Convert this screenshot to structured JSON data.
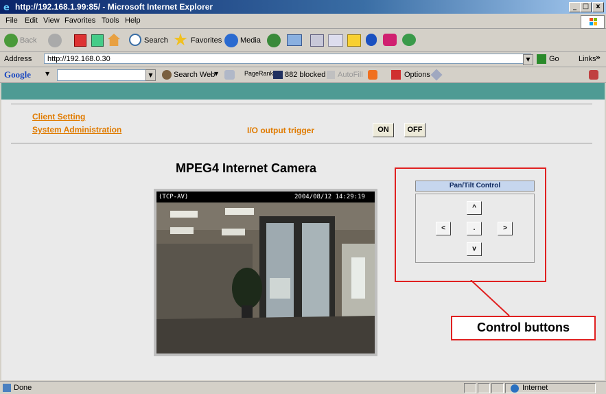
{
  "window": {
    "title": "http://192.168.1.99:85/ - Microsoft Internet Explorer",
    "controls": {
      "minimize": "_",
      "maximize": "□",
      "close": "x"
    }
  },
  "menu": [
    "File",
    "Edit",
    "View",
    "Favorites",
    "Tools",
    "Help"
  ],
  "toolbar": {
    "back": "Back",
    "search": "Search",
    "favorites": "Favorites",
    "media": "Media"
  },
  "address": {
    "label": "Address",
    "url": "http://192.168.0.30",
    "go": "Go",
    "links": "Links"
  },
  "googlebar": {
    "brand": "Google",
    "search_web": "Search Web",
    "pagerank": "PageRank",
    "blocked": "882 blocked",
    "autofill": "AutoFill",
    "options": "Options"
  },
  "page": {
    "links": {
      "client_setting": "Client Setting",
      "system_admin": "System Administration"
    },
    "io": {
      "label": "I/O output trigger",
      "on": "ON",
      "off": "OFF"
    },
    "camera_title": "MPEG4 Internet Camera",
    "video": {
      "left_overlay": "(TCP-AV)",
      "right_overlay": "2004/08/12 14:29:19"
    },
    "ptz": {
      "header": "Pan/Tilt Control",
      "up": "^",
      "left": "<",
      "home": ".",
      "right": ">",
      "down": "v"
    },
    "callout": "Control buttons"
  },
  "status": {
    "text": "Done",
    "zone": "Internet"
  },
  "colors": {
    "teal_bar": "#4e9b94",
    "link_orange": "#e07b00",
    "callout_red": "#e02020"
  }
}
